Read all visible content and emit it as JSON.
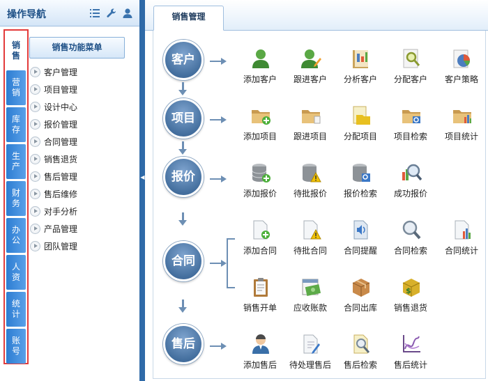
{
  "nav": {
    "title": "操作导航",
    "header_icons": [
      "list-icon",
      "wrench-icon",
      "user-icon"
    ],
    "categories": [
      {
        "label": "销售",
        "active": true
      },
      {
        "label": "营销"
      },
      {
        "label": "库存"
      },
      {
        "label": "生产"
      },
      {
        "label": "财务"
      },
      {
        "label": "办公"
      },
      {
        "label": "人资"
      },
      {
        "label": "统计"
      },
      {
        "label": "账号"
      }
    ],
    "menu_title": "销售功能菜单",
    "menu_items": [
      "客户管理",
      "项目管理",
      "设计中心",
      "报价管理",
      "合同管理",
      "销售退货",
      "售后管理",
      "售后维修",
      "对手分析",
      "产品管理",
      "团队管理"
    ]
  },
  "tab": {
    "label": "销售管理"
  },
  "flow": {
    "stages": [
      "客户",
      "项目",
      "报价",
      "合同",
      "售后"
    ],
    "customer": [
      "添加客户",
      "跟进客户",
      "分析客户",
      "分配客户",
      "客户策略"
    ],
    "project": [
      "添加项目",
      "跟进项目",
      "分配项目",
      "项目检索",
      "项目统计"
    ],
    "quote": [
      "添加报价",
      "待批报价",
      "报价检索",
      "成功报价"
    ],
    "contract_row1": [
      "添加合同",
      "待批合同",
      "合同提醒",
      "合同检索",
      "合同统计"
    ],
    "contract_row2": [
      "销售开单",
      "应收账款",
      "合同出库",
      "销售退货"
    ],
    "aftersale": [
      "添加售后",
      "待处理售后",
      "售后检索",
      "售后统计"
    ]
  },
  "colors": {
    "brand_blue": "#2f6aa8",
    "stage_circle": "#45709f",
    "highlight_border": "#e33a3a"
  }
}
